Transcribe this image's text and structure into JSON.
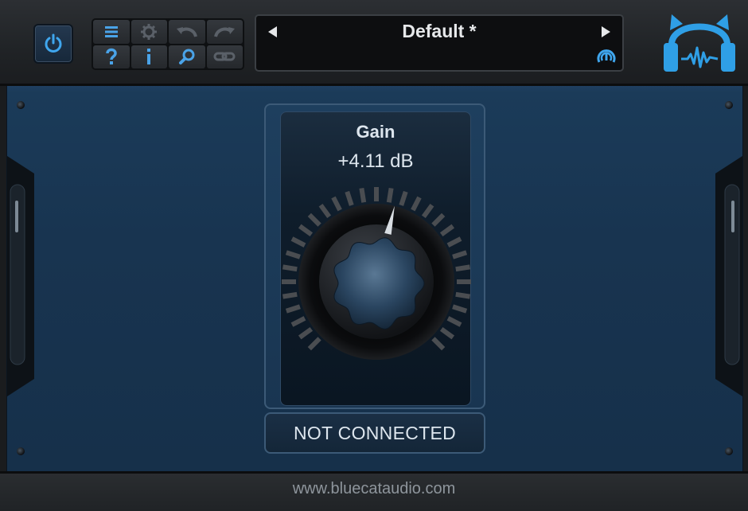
{
  "toolbar": {
    "power_icon": "power-icon",
    "tools": [
      {
        "name": "menu-icon",
        "color": "#4aa3e8"
      },
      {
        "name": "gear-icon",
        "color": "#5a6068"
      },
      {
        "name": "undo-icon",
        "color": "#5a6068"
      },
      {
        "name": "redo-icon",
        "color": "#5a6068"
      },
      {
        "name": "help-icon",
        "color": "#4aa3e8"
      },
      {
        "name": "info-icon",
        "color": "#4aa3e8"
      },
      {
        "name": "zoom-icon",
        "color": "#4aa3e8"
      },
      {
        "name": "link-icon",
        "color": "#5a6068"
      }
    ]
  },
  "preset": {
    "name": "Default *",
    "prev_icon": "triangle-left-icon",
    "next_icon": "triangle-right-icon",
    "status_icon": "sync-icon"
  },
  "logo": {
    "icon": "blue-cat-headphones-logo",
    "color": "#2f9fe6"
  },
  "knob": {
    "title": "Gain",
    "value_text": "+4.11 dB",
    "normalized_value": 0.55
  },
  "status": {
    "text": "NOT CONNECTED"
  },
  "footer": {
    "url_text": "www.bluecataudio.com"
  },
  "colors": {
    "accent": "#3a9ee6",
    "panel": "#183450",
    "text": "#dde6ee"
  }
}
